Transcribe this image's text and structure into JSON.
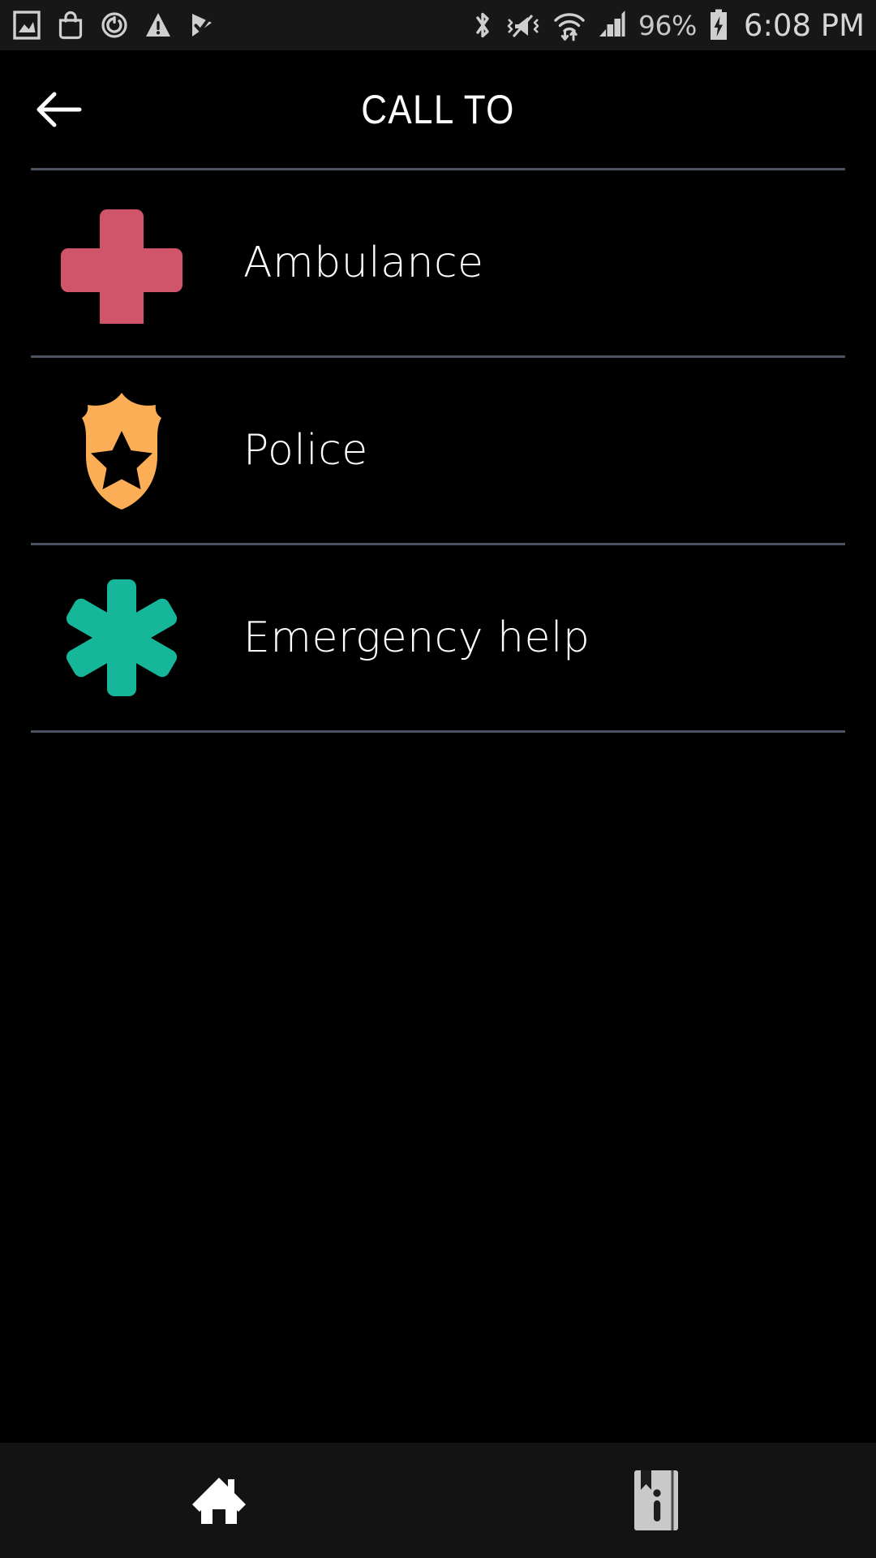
{
  "status_bar": {
    "left_icons": [
      {
        "name": "photo-image-icon",
        "label": "Screenshot captured"
      },
      {
        "name": "shopping-bag-icon",
        "label": "Play Store"
      },
      {
        "name": "sync-update-icon",
        "label": "Software update"
      },
      {
        "name": "warning-triangle-icon",
        "label": "Warning"
      },
      {
        "name": "play-protect-check-icon",
        "label": "Play Protect"
      }
    ],
    "right_icons": [
      {
        "name": "bluetooth-icon",
        "label": "Bluetooth on"
      },
      {
        "name": "mute-vibrate-icon",
        "label": "Sound muted"
      },
      {
        "name": "wifi-transfer-icon",
        "label": "Wi-Fi connected"
      },
      {
        "name": "cellular-signal-icon",
        "label": "Cellular signal"
      }
    ],
    "battery_percent": "96%",
    "battery_state": "charging",
    "clock": "6:08 PM"
  },
  "header": {
    "back_label": "Back",
    "title": "CALL TO"
  },
  "list": {
    "items": [
      {
        "label": "Ambulance",
        "icon": "medical-cross-icon",
        "color": "#d1556a"
      },
      {
        "label": "Police",
        "icon": "police-badge-shield-icon",
        "color": "#fbae56"
      },
      {
        "label": "Emergency help",
        "icon": "star-of-life-icon",
        "color": "#16b69a"
      }
    ]
  },
  "bottom_nav": {
    "items": [
      {
        "name": "home",
        "icon": "home-icon",
        "label": "Home",
        "active": true
      },
      {
        "name": "info",
        "icon": "book-info-icon",
        "label": "Info",
        "active": false
      }
    ]
  },
  "colors": {
    "background": "#000000",
    "status_bar_bg": "#171717",
    "bottom_nav_bg": "#131313",
    "divider": "#4b5360",
    "text_primary": "#ffffff",
    "status_text": "#c8c8c8",
    "nav_active": "#ffffff",
    "nav_inactive": "#c9c9c9"
  }
}
